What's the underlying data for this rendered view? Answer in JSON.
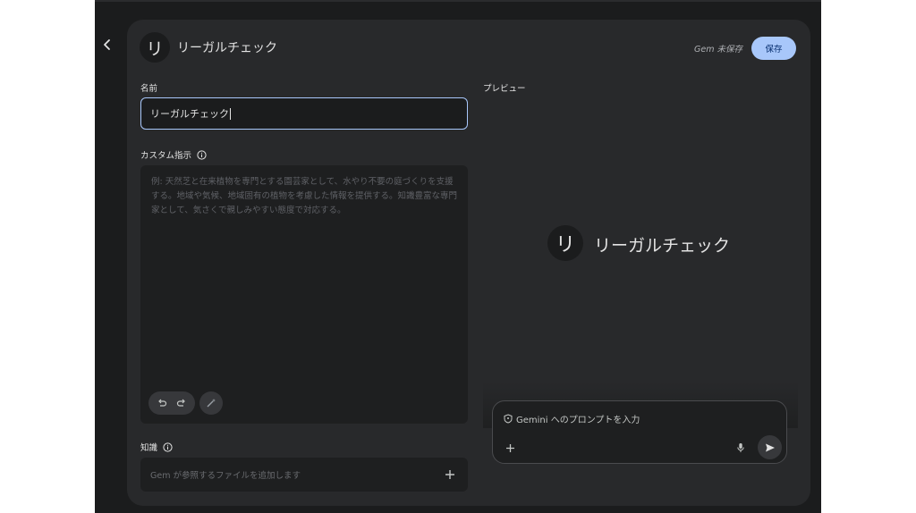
{
  "header": {
    "avatar_letter": "リ",
    "title": "リーガルチェック",
    "save_status": "Gem 未保存",
    "save_label": "保存"
  },
  "form": {
    "name_label": "名前",
    "name_value": "リーガルチェック",
    "instructions_label": "カスタム指示",
    "instructions_placeholder": "例: 天然芝と在来植物を専門とする園芸家として、水やり不要の庭づくりを支援する。地域や気候、地域固有の植物を考慮した情報を提供する。知識豊富な専門家として、気さくで親しみやすい態度で対応する。",
    "knowledge_label": "知識",
    "knowledge_placeholder": "Gem が参照するファイルを追加します"
  },
  "preview": {
    "label": "プレビュー",
    "avatar_letter": "リ",
    "title": "リーガルチェック",
    "prompt_placeholder": "Gemini へのプロンプトを入力"
  },
  "colors": {
    "app_background": "#1b1c1d",
    "card_background": "#28292b",
    "accent": "#a8c7fa",
    "text": "#e3e3e3"
  },
  "icons": [
    "back-arrow-icon",
    "info-icon",
    "undo-icon",
    "redo-icon",
    "magic-wand-icon",
    "plus-icon",
    "shield-icon",
    "mic-icon",
    "send-icon"
  ]
}
